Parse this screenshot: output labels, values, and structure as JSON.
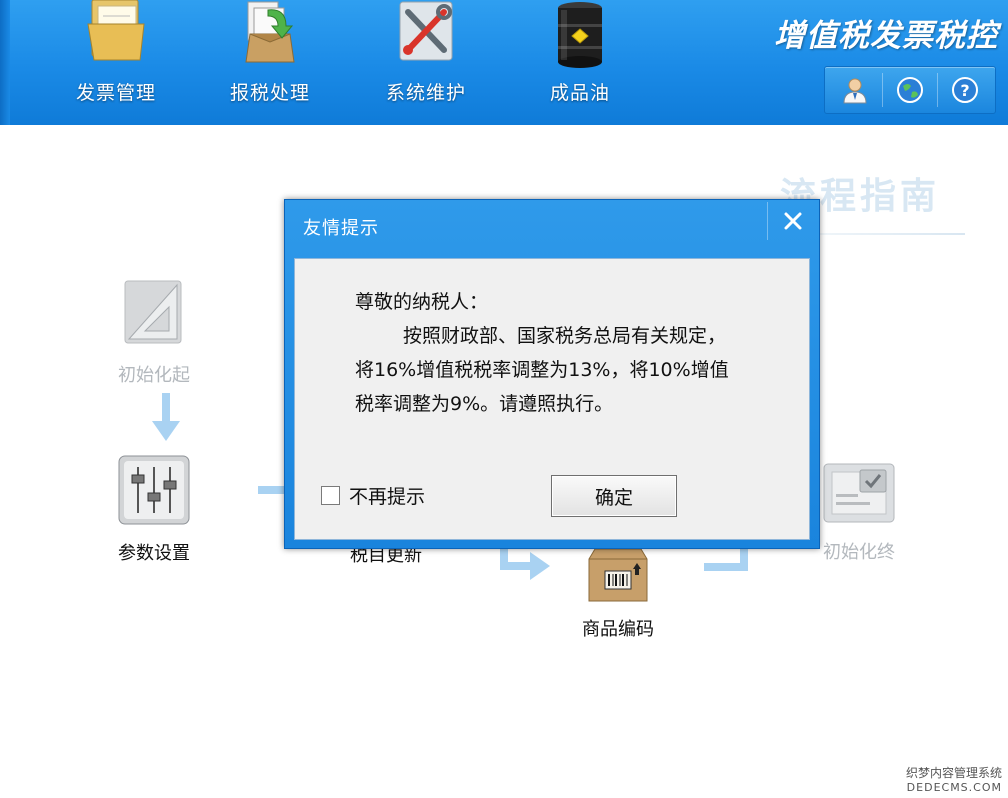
{
  "header": {
    "app_title": "增值税发票税控",
    "nav": [
      {
        "label": "发票管理",
        "icon": "folder-icon"
      },
      {
        "label": "报税处理",
        "icon": "tax-report-box-icon"
      },
      {
        "label": "系统维护",
        "icon": "tools-icon"
      },
      {
        "label": "成品油",
        "icon": "oil-barrel-icon"
      }
    ],
    "toolbar": [
      "user-icon",
      "globe-icon",
      "help-icon"
    ]
  },
  "guide": {
    "title": "流程指南",
    "nodes": [
      {
        "label": "初始化起",
        "state": "disabled"
      },
      {
        "label": "参数设置",
        "state": "enabled"
      },
      {
        "label": "税目更新",
        "state": "enabled"
      },
      {
        "label": "商品编码",
        "state": "enabled"
      },
      {
        "label": "初始化终",
        "state": "disabled"
      }
    ]
  },
  "dialog": {
    "title": "友情提示",
    "greeting": "尊敬的纳税人：",
    "line1": "按照财政部、国家税务总局有关规定，",
    "line2": "将16%增值税税率调整为13%，将10%增值",
    "line3": "税率调整为9%。请遵照执行。",
    "checkbox_label": "不再提示",
    "checkbox_checked": false,
    "ok_label": "确定"
  },
  "watermark": {
    "line1": "织梦内容管理系统",
    "line2": "DEDECMS.COM"
  },
  "colors": {
    "header_blue": "#1a8ae6",
    "dialog_blue": "#2489e2",
    "muted_text": "#b3b8bd"
  }
}
